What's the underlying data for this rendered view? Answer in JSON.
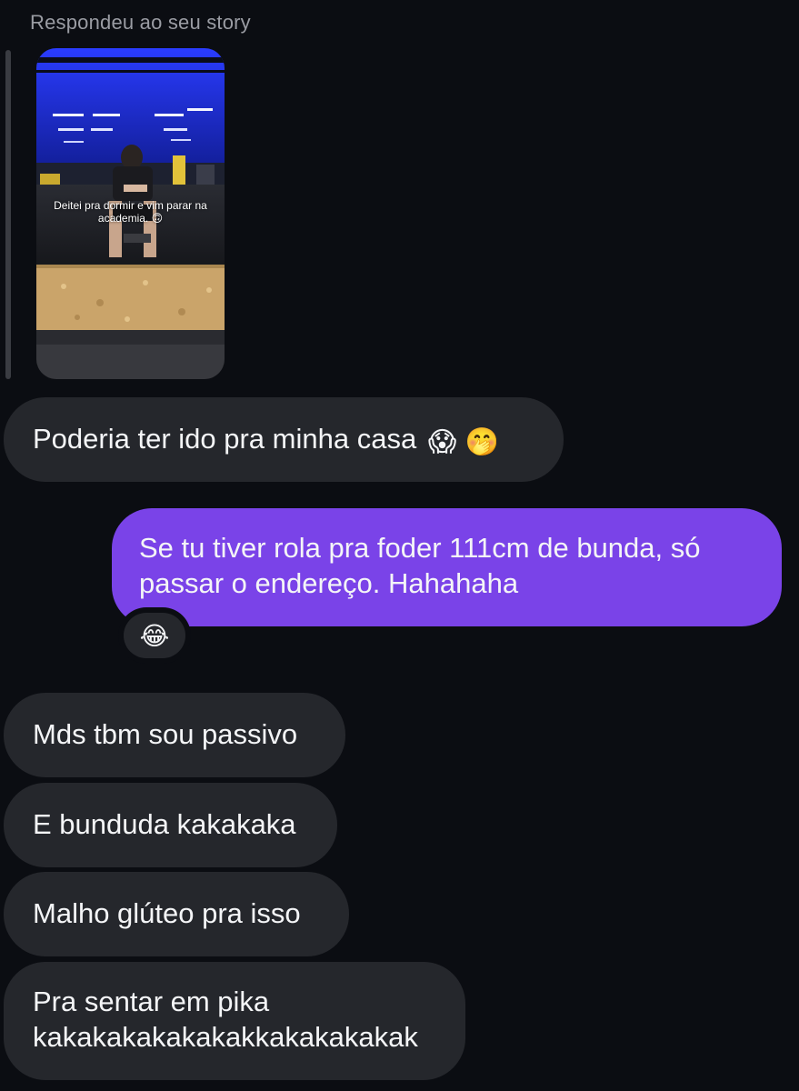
{
  "story": {
    "header": "Respondeu ao seu story",
    "caption": "Deitei pra dormir e vim parar na academia. 🙃"
  },
  "messages": [
    {
      "side": "in",
      "text": "Poderia ter ido pra minha casa",
      "emoji": "😱 🤭"
    },
    {
      "side": "out",
      "text": "Se tu tiver rola pra foder 111cm de bunda, só passar o endereço. Hahahaha",
      "reaction": "😂"
    },
    {
      "side": "in",
      "text": "Mds tbm sou passivo"
    },
    {
      "side": "in",
      "text": "E bunduda kakakaka"
    },
    {
      "side": "in",
      "text": "Malho glúteo pra isso"
    },
    {
      "side": "in",
      "line1": "Pra sentar em pika",
      "line2": "kakakakakakakakkakakakakak"
    }
  ],
  "colors": {
    "background": "#0b0d12",
    "incoming_bubble": "#25272c",
    "outgoing_bubble": "#7a43e8",
    "secondary_text": "#9a9ca3"
  }
}
